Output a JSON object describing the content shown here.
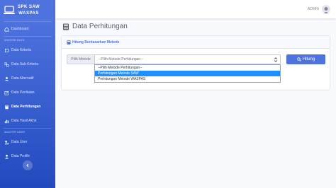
{
  "brand": {
    "line1": "SPK SAW",
    "line2": "WASPAS"
  },
  "sidebar": {
    "dashboard": "Dashboard",
    "heading_master_data": "MASTER DATA",
    "items": [
      {
        "label": "Data Kriteria"
      },
      {
        "label": "Data Sub Kriteria"
      },
      {
        "label": "Data Alternatif"
      },
      {
        "label": "Data Penilaian"
      },
      {
        "label": "Data Perhitungan"
      },
      {
        "label": "Data Hasil Akhir"
      }
    ],
    "heading_master_user": "MASTER USER",
    "user_items": [
      {
        "label": "Data User"
      },
      {
        "label": "Data Profile"
      }
    ]
  },
  "topbar": {
    "user_name": "ADMIN"
  },
  "page": {
    "title": "Data Perhitungan"
  },
  "card": {
    "header": "Hitung Berdasarkan Metode",
    "field_label": "Pilih Metode",
    "select_value": "--Pilih Metode Perhitungan--",
    "options": [
      "--Pilih Metode Perhitungan--",
      "Perhitungan Metode SAW",
      "Perhitungan Metode WASPAS"
    ],
    "button": "Hitung"
  },
  "colors": {
    "primary": "#4e73df",
    "sidebar_end": "#224abe",
    "option_highlight": "#1e90ff"
  }
}
